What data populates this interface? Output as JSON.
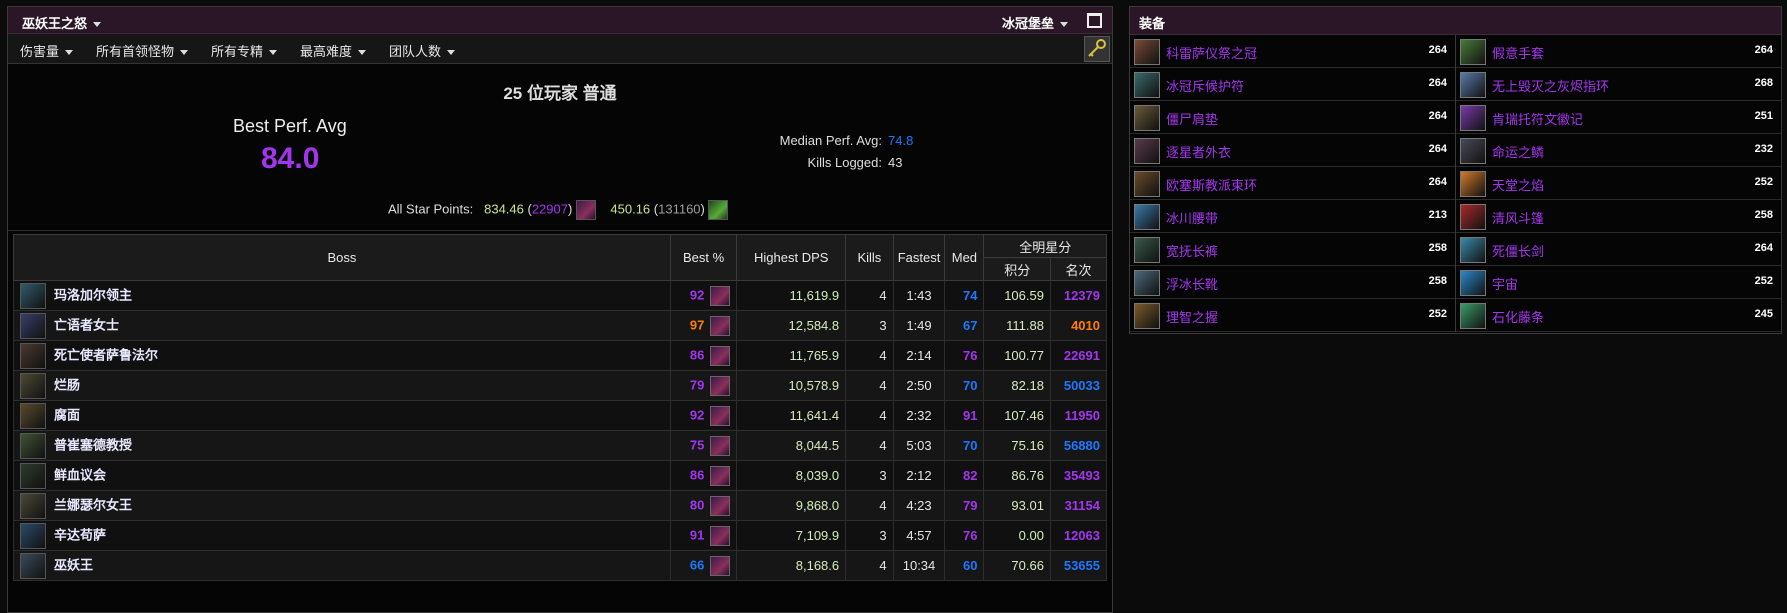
{
  "header": {
    "zone_title": "巫妖王之怒",
    "raid_select": "冰冠堡垒"
  },
  "filters": [
    "伤害量",
    "所有首领怪物",
    "所有专精",
    "最高难度",
    "团队人数"
  ],
  "summary": {
    "title": "25 位玩家 普通",
    "best_perf_label": "Best Perf. Avg",
    "best_perf_value": "84.0",
    "median_label": "Median Perf. Avg:",
    "median_value": "74.8",
    "kills_label": "Kills Logged:",
    "kills_value": "43",
    "star_label": "All Star Points:",
    "star1_points": "834.46",
    "star1_rank": "22907",
    "star2_points": "450.16",
    "star2_rank": "131160"
  },
  "table": {
    "headers": {
      "boss": "Boss",
      "best": "Best %",
      "dps": "Highest DPS",
      "kills": "Kills",
      "fastest": "Fastest",
      "med": "Med",
      "allstar": "全明星分",
      "points": "积分",
      "rank": "名次"
    },
    "rows": [
      {
        "boss": "玛洛加尔领主",
        "best": "92",
        "best_color": "#a335ee",
        "dps": "11,619.9",
        "kills": "4",
        "fastest": "1:43",
        "med": "74",
        "med_color": "#1e78ff",
        "points": "106.59",
        "rank": "12379",
        "rank_color": "#a335ee",
        "icon": "#2f5c6a"
      },
      {
        "boss": "亡语者女士",
        "best": "97",
        "best_color": "#ff8000",
        "dps": "12,584.8",
        "kills": "3",
        "fastest": "1:49",
        "med": "67",
        "med_color": "#1e78ff",
        "points": "111.88",
        "rank": "4010",
        "rank_color": "#ff8000",
        "icon": "#3a3f6a"
      },
      {
        "boss": "死亡使者萨鲁法尔",
        "best": "86",
        "best_color": "#a335ee",
        "dps": "11,765.9",
        "kills": "4",
        "fastest": "2:14",
        "med": "76",
        "med_color": "#a335ee",
        "points": "100.77",
        "rank": "22691",
        "rank_color": "#a335ee",
        "icon": "#4a3a30"
      },
      {
        "boss": "烂肠",
        "best": "79",
        "best_color": "#a335ee",
        "dps": "10,578.9",
        "kills": "4",
        "fastest": "2:50",
        "med": "70",
        "med_color": "#1e78ff",
        "points": "82.18",
        "rank": "50033",
        "rank_color": "#1e78ff",
        "icon": "#4e4a36"
      },
      {
        "boss": "腐面",
        "best": "92",
        "best_color": "#a335ee",
        "dps": "11,641.4",
        "kills": "4",
        "fastest": "2:32",
        "med": "91",
        "med_color": "#a335ee",
        "points": "107.46",
        "rank": "11950",
        "rank_color": "#a335ee",
        "icon": "#5a4a2e"
      },
      {
        "boss": "普崔塞德教授",
        "best": "75",
        "best_color": "#a335ee",
        "dps": "8,044.5",
        "kills": "4",
        "fastest": "5:03",
        "med": "70",
        "med_color": "#1e78ff",
        "points": "75.16",
        "rank": "56880",
        "rank_color": "#1e78ff",
        "icon": "#3f5236"
      },
      {
        "boss": "鲜血议会",
        "best": "86",
        "best_color": "#a335ee",
        "dps": "8,039.0",
        "kills": "3",
        "fastest": "2:12",
        "med": "82",
        "med_color": "#a335ee",
        "points": "86.76",
        "rank": "35493",
        "rank_color": "#a335ee",
        "icon": "#2e3a2e"
      },
      {
        "boss": "兰娜瑟尔女王",
        "best": "80",
        "best_color": "#a335ee",
        "dps": "9,868.0",
        "kills": "4",
        "fastest": "4:23",
        "med": "79",
        "med_color": "#a335ee",
        "points": "93.01",
        "rank": "31154",
        "rank_color": "#a335ee",
        "icon": "#4a4a3a"
      },
      {
        "boss": "辛达苟萨",
        "best": "91",
        "best_color": "#a335ee",
        "dps": "7,109.9",
        "kills": "3",
        "fastest": "4:57",
        "med": "76",
        "med_color": "#a335ee",
        "points": "0.00",
        "rank": "12063",
        "rank_color": "#a335ee",
        "icon": "#2c4a6a"
      },
      {
        "boss": "巫妖王",
        "best": "66",
        "best_color": "#1e78ff",
        "dps": "8,168.6",
        "kills": "4",
        "fastest": "10:34",
        "med": "60",
        "med_color": "#1e78ff",
        "points": "70.66",
        "rank": "53655",
        "rank_color": "#1e78ff",
        "icon": "#3a4a5a"
      }
    ]
  },
  "equipment": {
    "title": "装备",
    "left": [
      {
        "name": "科雷萨仪祭之冠",
        "ilvl": "264",
        "icon": "#7a4a3a"
      },
      {
        "name": "冰冠斥候护符",
        "ilvl": "264",
        "icon": "#3a6a6a"
      },
      {
        "name": "僵尸肩垫",
        "ilvl": "264",
        "icon": "#6a5a3a"
      },
      {
        "name": "逐星者外衣",
        "ilvl": "264",
        "icon": "#5a3a4a"
      },
      {
        "name": "欧塞斯教派束环",
        "ilvl": "264",
        "icon": "#6a4a2a"
      },
      {
        "name": "冰川腰带",
        "ilvl": "213",
        "icon": "#3a7aaa"
      },
      {
        "name": "宽抚长裤",
        "ilvl": "258",
        "icon": "#3a5a4a"
      },
      {
        "name": "浮冰长靴",
        "ilvl": "258",
        "icon": "#4a6a7a"
      },
      {
        "name": "理智之握",
        "ilvl": "252",
        "icon": "#7a5a2a"
      }
    ],
    "right": [
      {
        "name": "假意手套",
        "ilvl": "264",
        "icon": "#4a7a3a"
      },
      {
        "name": "无上毁灭之灰烬指环",
        "ilvl": "268",
        "icon": "#5a7aaa"
      },
      {
        "name": "肯瑞托符文徽记",
        "ilvl": "251",
        "icon": "#7a3aaa"
      },
      {
        "name": "命运之鳞",
        "ilvl": "232",
        "icon": "#4a4a5a"
      },
      {
        "name": "天堂之焰",
        "ilvl": "252",
        "icon": "#d07a2a"
      },
      {
        "name": "清风斗篷",
        "ilvl": "258",
        "icon": "#aa2a2a"
      },
      {
        "name": "死僵长剑",
        "ilvl": "264",
        "icon": "#3a8aaa"
      },
      {
        "name": "宇宙",
        "ilvl": "252",
        "icon": "#2a8aca"
      },
      {
        "name": "石化藤条",
        "ilvl": "245",
        "icon": "#3a9a6a"
      }
    ]
  }
}
